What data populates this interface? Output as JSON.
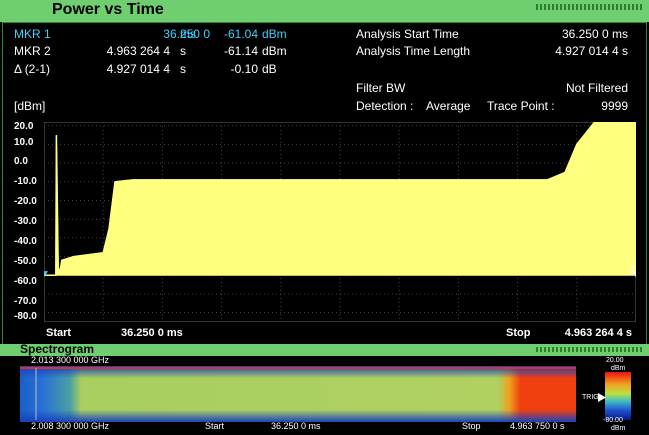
{
  "window": {
    "title": "Power vs Time"
  },
  "markers": [
    {
      "name": "MKR 1",
      "time": "36.250 0",
      "time_unit": "ms",
      "level": "-61.04",
      "level_unit": "dBm",
      "active": true
    },
    {
      "name": "MKR 2",
      "time": "4.963 264 4",
      "time_unit": "s",
      "level": "-61.14",
      "level_unit": "dBm",
      "active": false
    },
    {
      "name": "Δ (2-1)",
      "time": "4.927 014 4",
      "time_unit": "s",
      "level": "-0.10",
      "level_unit": "dB",
      "active": false
    }
  ],
  "analysis": {
    "start_label": "Analysis Start Time",
    "start_value": "36.250 0 ms",
    "length_label": "Analysis Time Length",
    "length_value": "4.927 014 4 s",
    "filter_label": "Filter BW",
    "filter_value": "Not Filtered",
    "detection_label": "Detection :",
    "detection_value": "Average",
    "trace_point_label": "Trace Point :",
    "trace_point_value": "9999"
  },
  "chart_data": {
    "type": "area",
    "yunit": "[dBm]",
    "ylim": [
      -85,
      22
    ],
    "yticks": [
      "20.0",
      "10.0",
      "0.0",
      "-10.0",
      "-20.0",
      "-30.0",
      "-40.0",
      "-50.0",
      "-60.0",
      "-70.0",
      "-80.0"
    ],
    "x_start_label": "Start",
    "x_start_value": "36.250 0 ms",
    "x_stop_label": "Stop",
    "x_stop_value": "4.963 264 4 s",
    "xlim": [
      0,
      1
    ],
    "series": [
      {
        "color": "#ffff80",
        "x": [
          0,
          0.02,
          0.021,
          0.024,
          0.026,
          0.03,
          0.05,
          0.1,
          0.11,
          0.12,
          0.15,
          0.3,
          0.5,
          0.7,
          0.85,
          0.88,
          0.9,
          0.93,
          1.0
        ],
        "y": [
          -60,
          -60,
          15,
          -55,
          -60,
          -52,
          -50,
          -48,
          -35,
          -10,
          -9,
          -9,
          -9,
          -9,
          -9,
          -5,
          10,
          22,
          22
        ]
      }
    ],
    "markers": [
      {
        "label": "",
        "x": 0,
        "y": -61
      },
      {
        "label": "2",
        "x": 1,
        "y": -61
      }
    ]
  },
  "spectrogram": {
    "title": "Spectrogram",
    "freq_top": "2.013 300 000 GHz",
    "freq_bottom": "2.008 300 000 GHz",
    "start_label": "Start",
    "start_value": "36.250 0 ms",
    "stop_label": "Stop",
    "stop_value": "4.963 750 0 s",
    "scale_top": "20.00",
    "scale_top_unit": "dBm",
    "scale_bottom": "-80.00",
    "scale_bottom_unit": "dBm",
    "trig_label": "TRIG"
  }
}
